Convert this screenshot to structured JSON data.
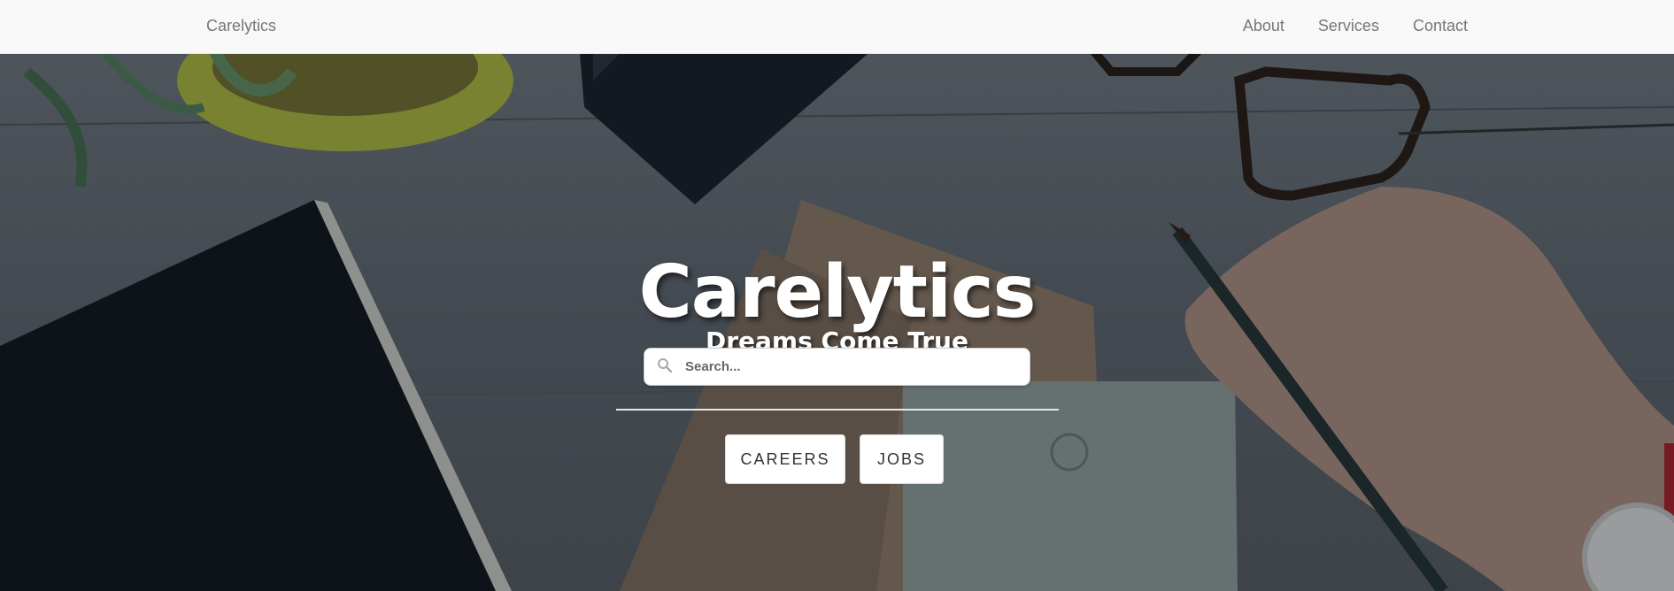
{
  "navbar": {
    "brand": "Carelytics",
    "links": [
      {
        "label": "About"
      },
      {
        "label": "Services"
      },
      {
        "label": "Contact"
      }
    ]
  },
  "hero": {
    "title": "Carelytics",
    "subtitle": "Dreams Come True",
    "search": {
      "placeholder": "Search...",
      "value": "",
      "icon": "search-icon"
    },
    "buttons": {
      "careers": "CAREERS",
      "jobs": "JOBS"
    }
  },
  "colors": {
    "navbar_bg": "#f8f8f8",
    "nav_text": "#777777",
    "hero_text": "#ffffff",
    "button_bg": "#ffffff",
    "button_text": "#333333"
  }
}
